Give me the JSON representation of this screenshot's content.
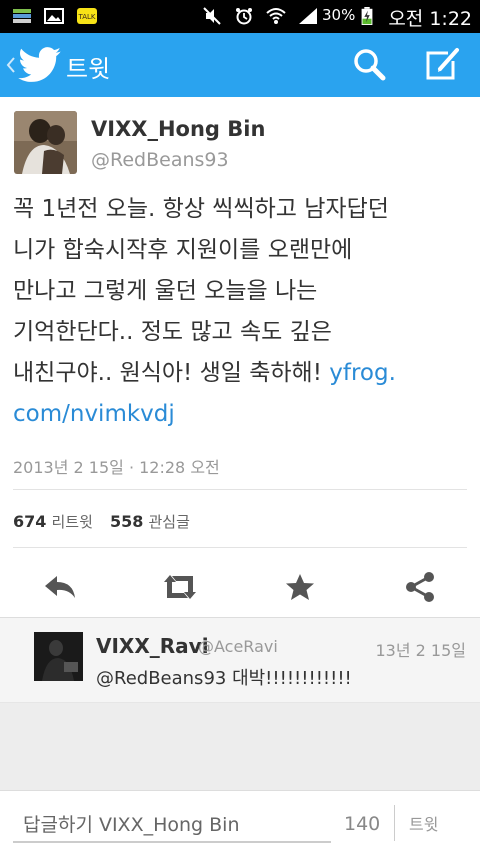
{
  "status_bar": {
    "battery": "30%",
    "time": "오전 1:22"
  },
  "header": {
    "title": "트윗",
    "icons": {
      "back": "chevron-left-icon",
      "logo": "twitter-bird-icon",
      "search": "search-icon",
      "compose": "compose-icon"
    },
    "color": "#2aa3ef"
  },
  "tweet": {
    "author_name": "VIXX_Hong Bin",
    "author_handle": "@RedBeans93",
    "lines": [
      "꼭 1년전 오늘. 항상 씩씩하고 남자답던",
      "니가 합숙시작후 지원이를 오랜만에",
      "만나고 그렇게 울던 오늘을 나는",
      "기억한단다.. 정도 많고 속도 깊은"
    ],
    "line5_text": "내친구야.. 원식아! 생일 축하해! ",
    "link_part1": "yfrog.",
    "link_part2": "com/nvimkvdj",
    "timestamp": "2013년 2 15일 · 12:28 오전",
    "retweet_count": "674",
    "retweet_label": "리트윗",
    "favorite_count": "558",
    "favorite_label": "관심글",
    "link_color": "#2a8bd6"
  },
  "actions": {
    "reply": "reply-icon",
    "retweet": "retweet-icon",
    "favorite": "star-icon",
    "share": "share-icon"
  },
  "reply": {
    "name": "VIXX_Ravi",
    "handle": "@AceRavi",
    "time": "13년 2 15일",
    "text": "@RedBeans93 대박!!!!!!!!!!!!"
  },
  "composer": {
    "placeholder": "답글하기 VIXX_Hong Bin",
    "char_count": "140",
    "tweet_button": "트윗"
  }
}
